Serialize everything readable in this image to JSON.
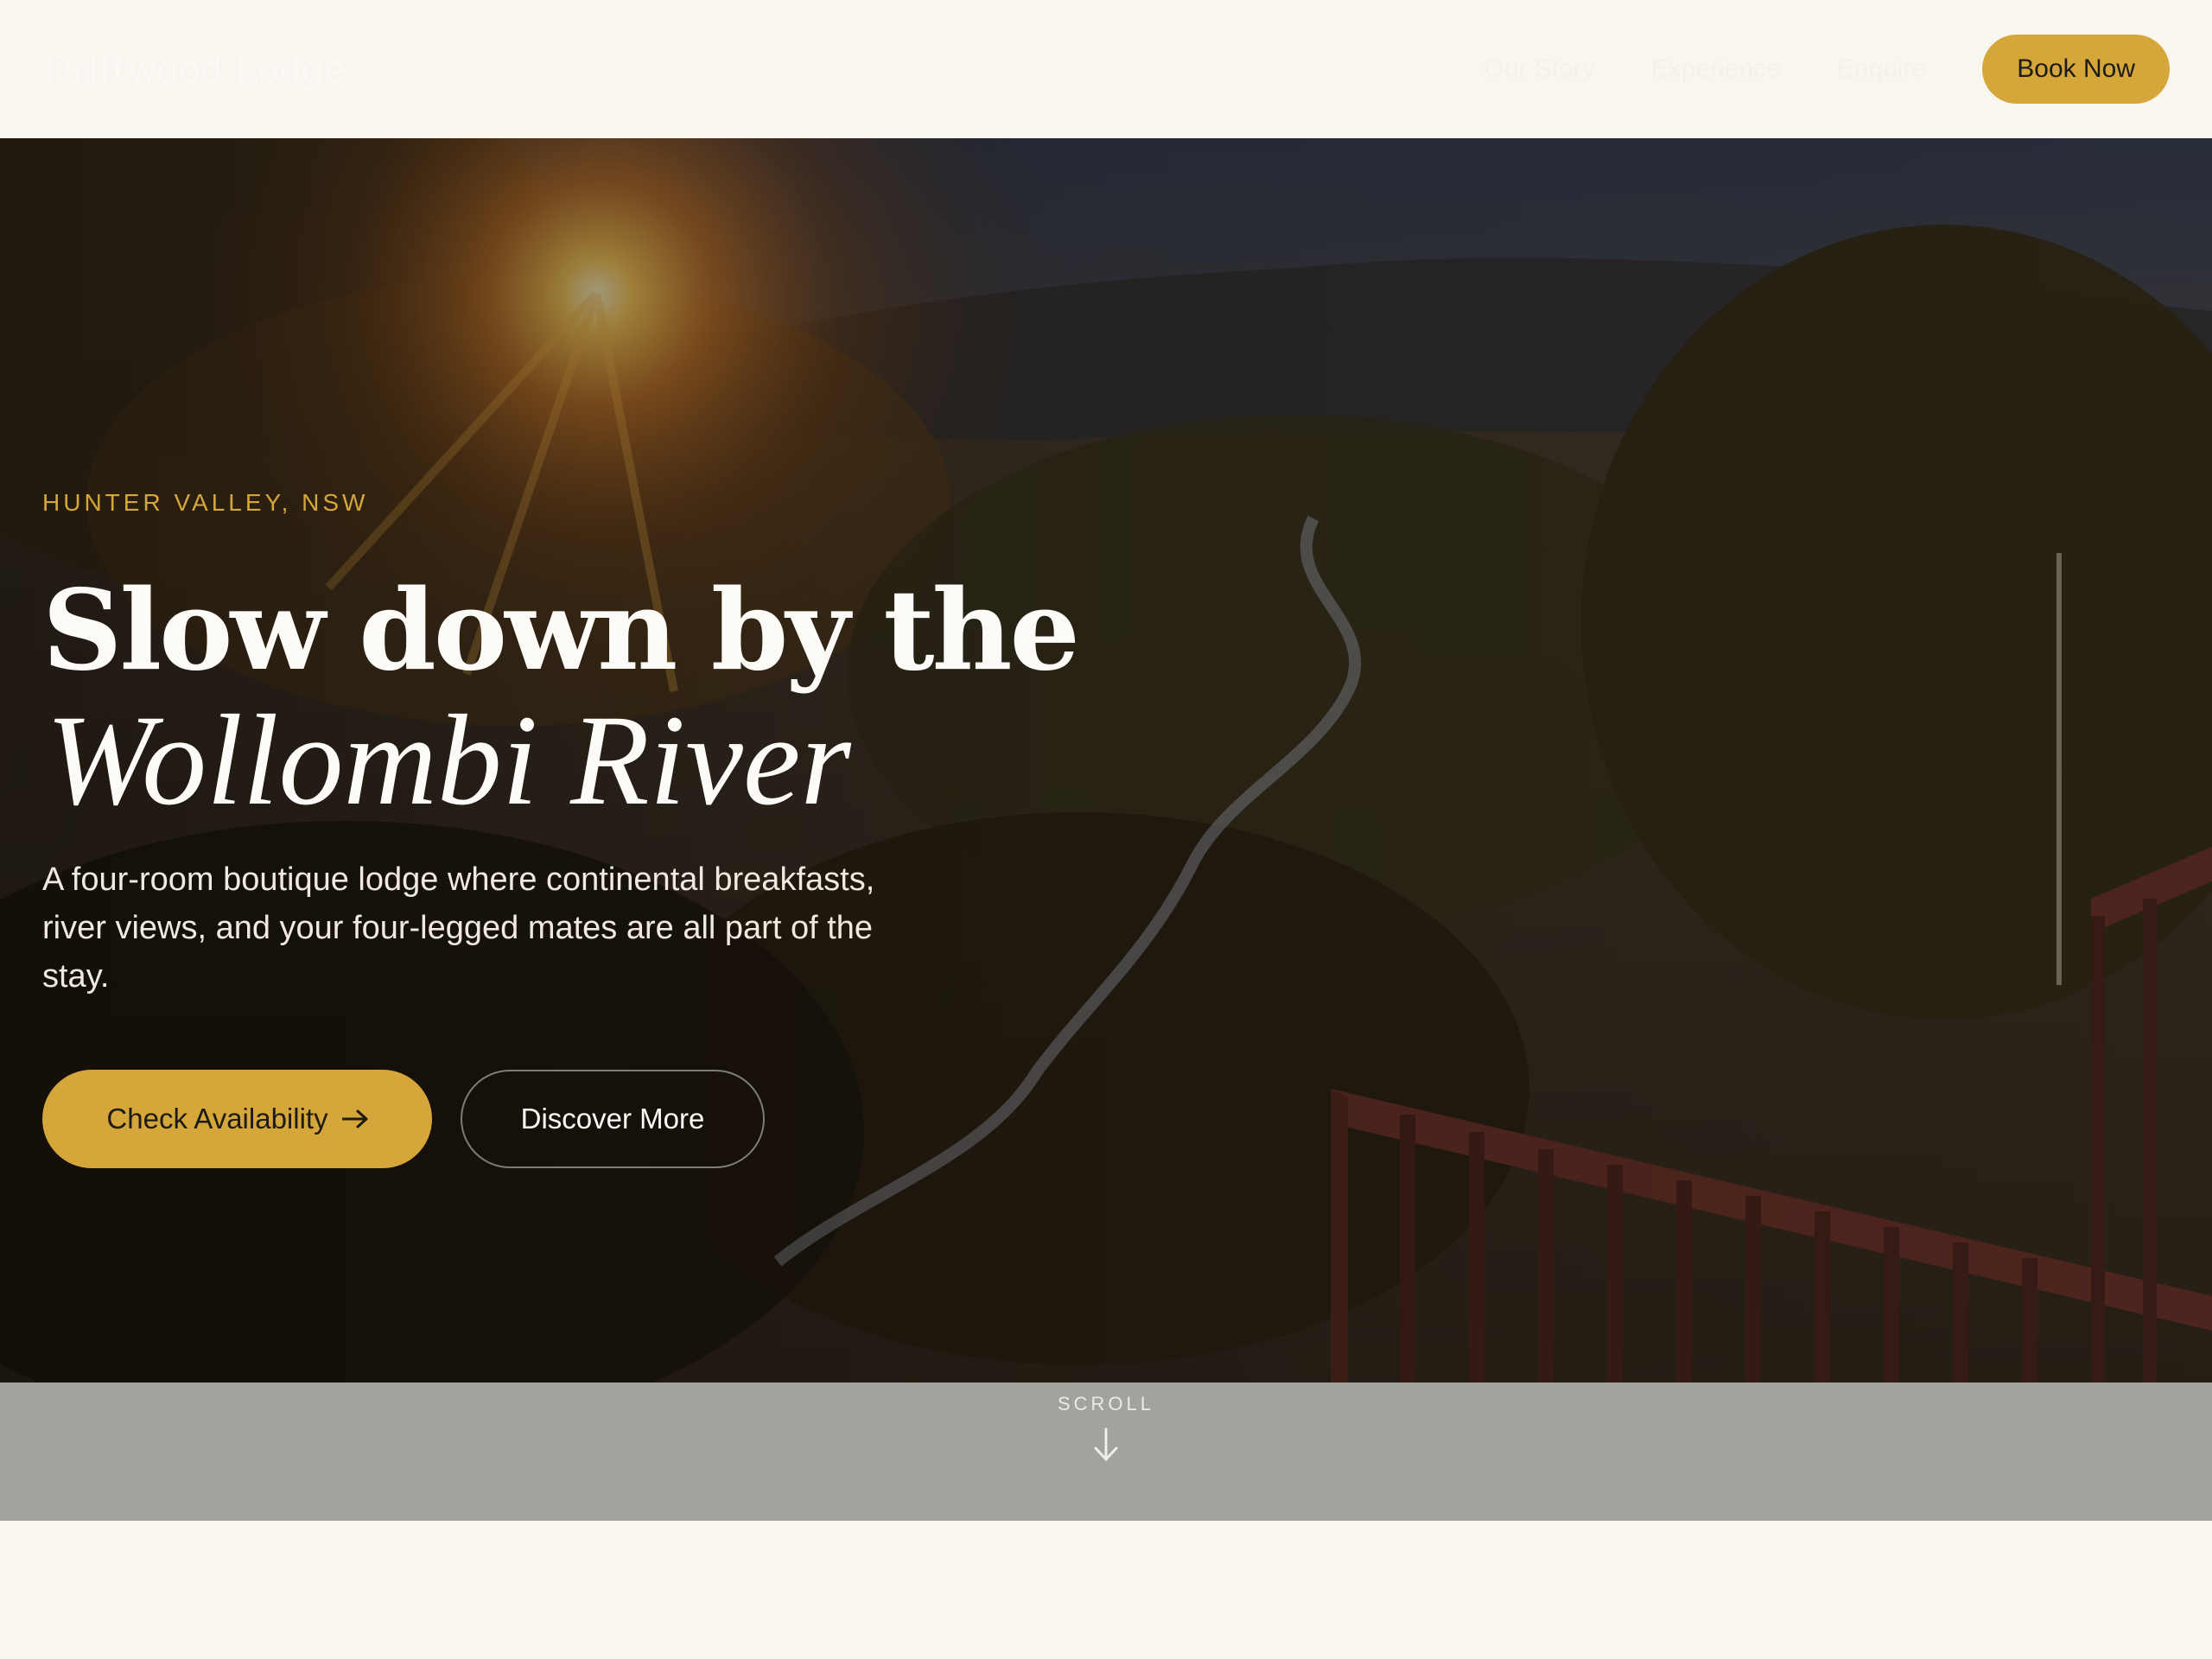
{
  "header": {
    "logo": "Driftwood Lodge",
    "nav": [
      {
        "label": "Our Story"
      },
      {
        "label": "Experience"
      },
      {
        "label": "Enquire"
      }
    ],
    "book_label": "Book Now"
  },
  "hero": {
    "eyebrow": "HUNTER VALLEY, NSW",
    "headline": "Slow down by the",
    "headline_italic": "Wollombi River",
    "lede": "A four-room boutique lodge where continental breakfasts, river views, and your four-legged mates are all part of the stay.",
    "primary_cta": "Check Availability",
    "primary_cta_icon": "arrow-right-icon",
    "secondary_cta": "Discover More"
  },
  "scroll": {
    "label": "SCROLL",
    "icon": "arrow-down-icon"
  },
  "colors": {
    "accent": "#d5a63a",
    "page_bg": "#f9f6ef",
    "scroll_band": "#a3a29d"
  }
}
